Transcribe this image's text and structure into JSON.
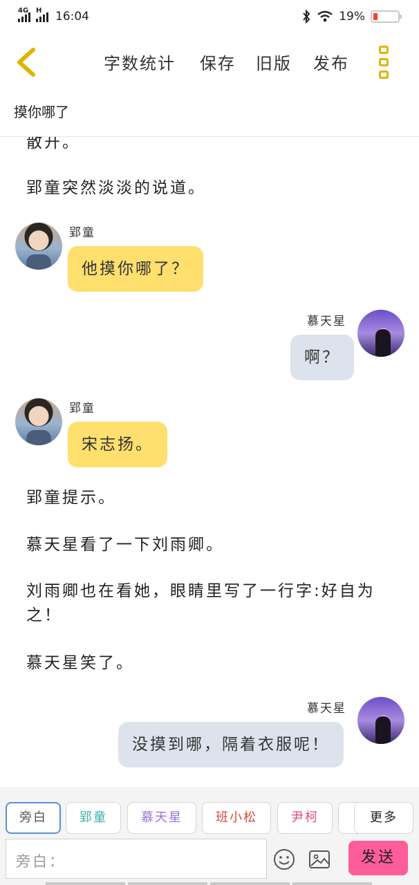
{
  "status_bar": {
    "network_1": "4G",
    "network_2": "H",
    "time": "16:04",
    "battery_percent": "19%",
    "battery_level": 0.19
  },
  "toolbar": {
    "back_icon": "chevron-left-icon",
    "word_count": "字数统计",
    "save": "保存",
    "old_version": "旧版",
    "publish": "发布",
    "more_icon": "more-vertical-icon",
    "accent_color": "#e0b400"
  },
  "document": {
    "title": "摸你哪了"
  },
  "content": {
    "narration_top_cut": "散开。",
    "narration_1": "郢童突然淡淡的说道。",
    "msg1": {
      "speaker": "郢童",
      "text": "他摸你哪了？"
    },
    "msg2": {
      "speaker": "慕天星",
      "text": "啊？"
    },
    "msg3": {
      "speaker": "郢童",
      "text": "宋志扬。"
    },
    "narration_2": "郢童提示。",
    "narration_3": "慕天星看了一下刘雨卿。",
    "narration_4_line1": "刘雨卿也在看她，眼睛里写了一行字:好自为",
    "narration_4_line2": "之！",
    "narration_5": "慕天星笑了。",
    "msg4": {
      "speaker": "慕天星",
      "text": "没摸到哪，隔着衣服呢！"
    }
  },
  "characters_bar": {
    "chips": [
      {
        "label": "旁白",
        "color": "#555555"
      },
      {
        "label": "郢童",
        "color": "#3ab0a6"
      },
      {
        "label": "慕天星",
        "color": "#a070d8"
      },
      {
        "label": "班小松",
        "color": "#e04a3a"
      },
      {
        "label": "尹柯",
        "color": "#e04a8a"
      }
    ],
    "more": "更多"
  },
  "composer": {
    "placeholder": "旁白：",
    "emoji_icon": "emoji-icon",
    "image_icon": "image-icon",
    "send": "发送",
    "send_color": "#ff5c9a"
  }
}
